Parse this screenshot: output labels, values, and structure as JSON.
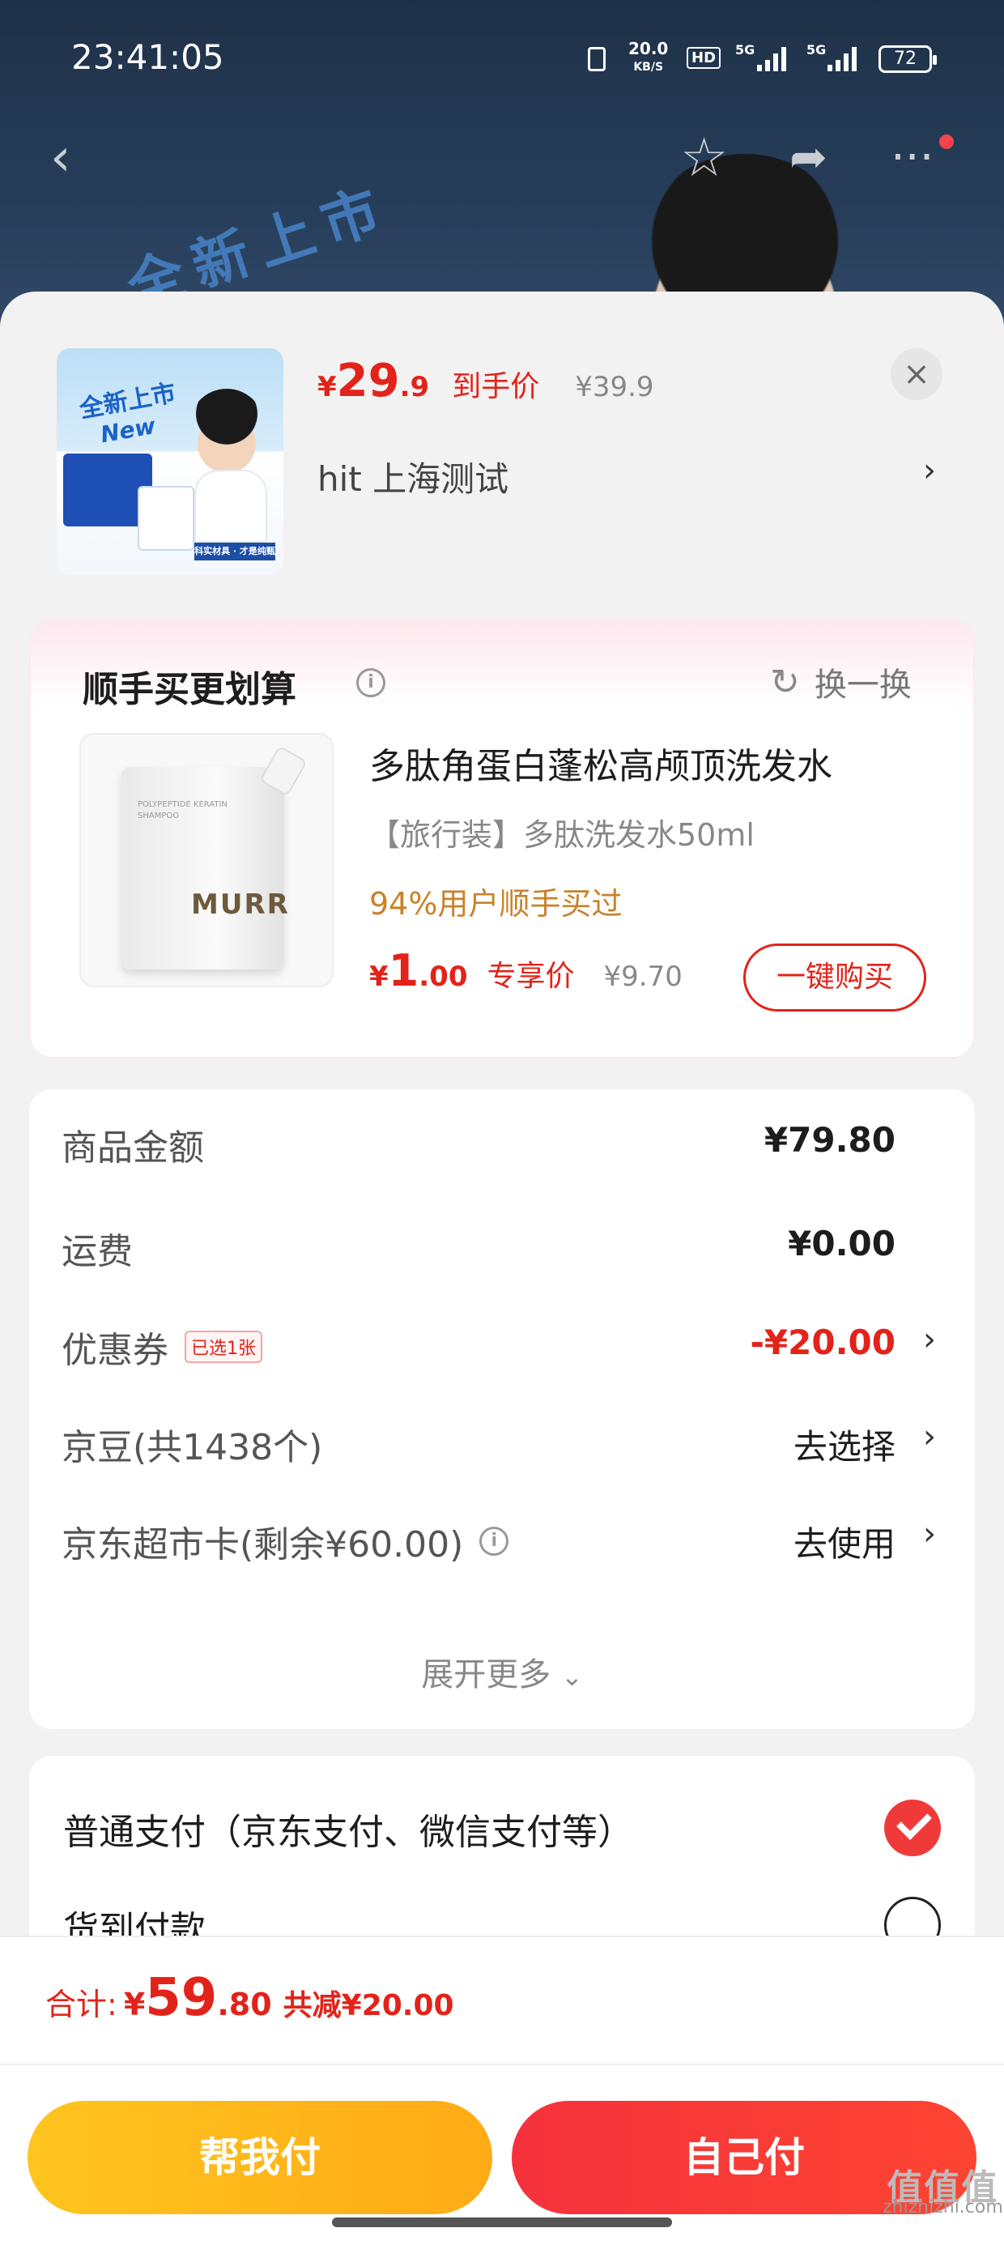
{
  "status_bar": {
    "time": "23:41:05",
    "net_speed": "20.0",
    "net_unit": "KB/S",
    "hd": "HD",
    "sig1": "5G",
    "sig2": "5G",
    "battery": "72"
  },
  "background": {
    "banner_text": "全新上市"
  },
  "product": {
    "thumb_tag": "全新上市",
    "thumb_tag_en": "New",
    "thumb_strip": "科实材具 · 才是纯甄",
    "price_currency": "¥",
    "price_int": "29",
    "price_dec": ".9",
    "price_label": "到手价",
    "original_price": "¥39.9",
    "shop": "hit  上海测试",
    "close": "×"
  },
  "upsell": {
    "title": "顺手买更划算",
    "swap_label": "换一换",
    "image_brand": "MURR",
    "name": "多肽角蛋白蓬松高颅顶洗发水",
    "spec": "【旅行装】多肽洗发水50ml",
    "rate": "94%用户顺手买过",
    "price_currency": "¥",
    "price_int": "1",
    "price_dec": ".00",
    "price_label": "专享价",
    "original_price": "¥9.70",
    "buy_label": "一键购买"
  },
  "summary": {
    "rows": [
      {
        "label": "商品金额",
        "value": "¥79.80"
      },
      {
        "label": "运费",
        "value": "¥0.00"
      },
      {
        "label": "优惠券",
        "tag": "已选1张",
        "value": "-¥20.00"
      },
      {
        "label": "京豆(共1438个)",
        "value": "去选择"
      },
      {
        "label": "京东超市卡(剩余¥60.00)",
        "value": "去使用"
      }
    ],
    "expand_label": "展开更多"
  },
  "payment": {
    "options": [
      {
        "label": "普通支付（京东支付、微信支付等）",
        "selected": true
      },
      {
        "label": "货到付款",
        "selected": false
      }
    ]
  },
  "bottom": {
    "total_label": "合计:",
    "currency": "¥",
    "total_int": "59",
    "total_dec": ".80",
    "discount": "共减¥20.00",
    "help_pay": "帮我付",
    "self_pay": "自己付"
  },
  "watermark": {
    "logo": "值值值",
    "site": "zhizhizhi.com"
  },
  "colors": {
    "accent_red": "#e2231a",
    "help_yellow": "#ffb81a",
    "rate_orange": "#c9822a"
  }
}
